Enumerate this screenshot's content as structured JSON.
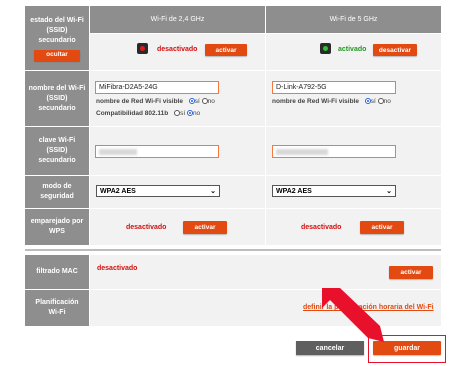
{
  "secondary_ssid": {
    "label": "estado del Wi-Fi (SSID) secundario",
    "hide_button": "ocultar",
    "col_24": "Wi-Fi de 2,4 GHz",
    "col_5": "Wi-Fi de 5 GHz",
    "status_24": "desactivado",
    "button_24": "activar",
    "status_5": "activado",
    "button_5": "desactivar",
    "led_24_color": "#e01b1b",
    "led_5_color": "#2fc12f"
  },
  "network_name": {
    "label": "nombre del Wi-Fi (SSID) secundario",
    "value_24": "MiFibra-D2A5-24G",
    "value_5": "D-Link-A792-5G",
    "visible_label": "nombre de Red Wi-Fi visible",
    "yes": "sí",
    "no": "no",
    "compat_label": "Compatibilidad 802.11b",
    "compat_yes": "sí",
    "compat_no": "no"
  },
  "key": {
    "label": "clave Wi-Fi (SSID) secundario"
  },
  "security": {
    "label": "modo de seguridad",
    "value_24": "WPA2 AES",
    "value_5": "WPA2 AES"
  },
  "wps": {
    "label": "emparejado por WPS",
    "status_24": "desactivado",
    "button_24": "activar",
    "status_5": "desactivado",
    "button_5": "activar"
  },
  "mac_filter": {
    "label": "filtrado MAC",
    "status": "desactivado",
    "button": "activar"
  },
  "schedule": {
    "label": "Planificación Wi-Fi",
    "link": "definir la planificación horaria del Wi-Fi"
  },
  "footer": {
    "cancel": "cancelar",
    "save": "guardar"
  },
  "colors": {
    "accent": "#e24a12",
    "label_bg": "#8e8e8e",
    "arrow": "#e8102a"
  }
}
